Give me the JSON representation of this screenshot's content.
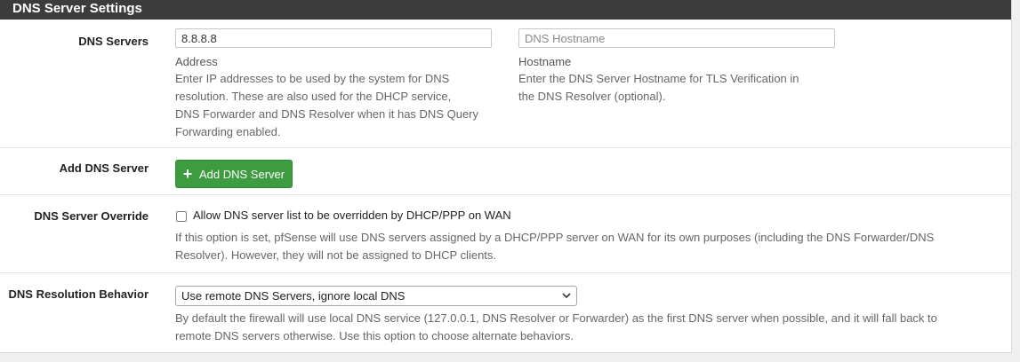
{
  "panel": {
    "title": "DNS Server Settings"
  },
  "dns_servers": {
    "label": "DNS Servers",
    "address_value": "8.8.8.8",
    "hostname_placeholder": "DNS Hostname",
    "address_sublabel": "Address",
    "address_help": [
      "Enter IP addresses to be used by the system for DNS",
      "resolution. These are also used for the DHCP service,",
      "DNS Forwarder and DNS Resolver when it has DNS Query",
      "Forwarding enabled."
    ],
    "hostname_sublabel": "Hostname",
    "hostname_help": [
      "Enter the DNS Server Hostname for TLS Verification in",
      "the DNS Resolver (optional)."
    ]
  },
  "add_dns": {
    "label": "Add DNS Server",
    "button_label": "Add DNS Server",
    "button_icon": "plus-icon"
  },
  "override": {
    "label": "DNS Server Override",
    "checkbox_label": "Allow DNS server list to be overridden by DHCP/PPP on WAN",
    "checked": false,
    "help": [
      "If this option is set, pfSense will use DNS servers assigned by a DHCP/PPP server on WAN for its own purposes (including the DNS Forwarder/DNS",
      "Resolver). However, they will not be assigned to DHCP clients."
    ]
  },
  "resolution": {
    "label": "DNS Resolution Behavior",
    "selected": "Use remote DNS Servers, ignore local DNS",
    "help": [
      "By default the firewall will use local DNS service (127.0.0.1, DNS Resolver or Forwarder) as the first DNS server when possible, and it will fall back to",
      "remote DNS servers otherwise. Use this option to choose alternate behaviors."
    ]
  },
  "colors": {
    "header_bg": "#3c3c3c",
    "button_green": "#3d9b40"
  }
}
